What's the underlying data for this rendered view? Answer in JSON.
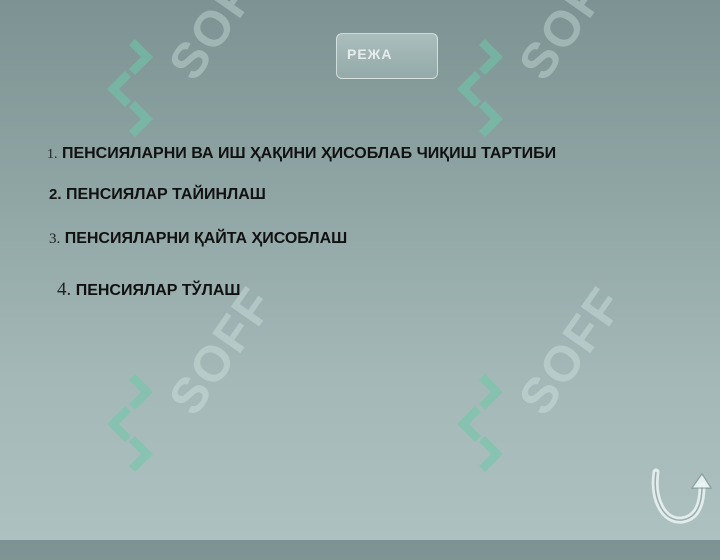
{
  "header": {
    "badge_text": "РЕЖА"
  },
  "menu": {
    "items": [
      {
        "number": "1.",
        "label": "ПЕНСИЯЛАРНИ ВА ИШ ҲАҚИНИ ҲИСОБЛАБ ЧИҚИШ ТАРТИБИ"
      },
      {
        "number": "2.",
        "label": "ПЕНСИЯЛАР ТАЙИНЛАШ"
      },
      {
        "number": "3.",
        "label": "ПЕНСИЯЛАРНИ ҚАЙТА ҲИСОБЛАШ"
      },
      {
        "number": "4.",
        "label": "ПЕНСИЯЛАР ТЎЛАШ"
      }
    ]
  },
  "watermark": {
    "text": "SOFF",
    "color": "#e1f5f0"
  },
  "icons": {
    "nav_arrow": "curved-arrow-icon",
    "watermark_logo": "soff-logo-icon"
  }
}
